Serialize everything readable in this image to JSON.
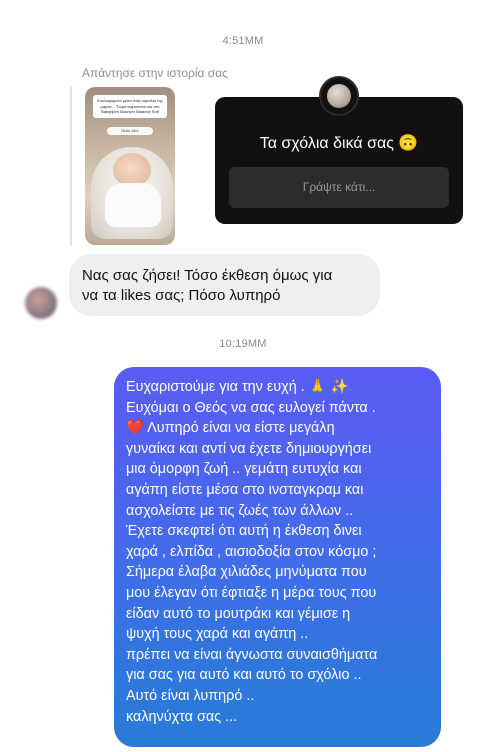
{
  "thread": {
    "timestamp_1": "4:51MM",
    "timestamp_2": "10:19MM"
  },
  "story_reply": {
    "label": "Απάντησε στην ιστορία σας",
    "thumbnail_caption": "Κυκλοφορούν μέσα στην αγκαλιά της μαμάς... Τώρα κοιμούνται και στο Babybjörn Bouncer Balance Soft",
    "thumbnail_sticker": "Πείτε εδώ",
    "sticker_title": "Τα σχόλια δικά σας 🙃",
    "sticker_placeholder": "Γράψτε κάτι..."
  },
  "incoming_message": {
    "lines": [
      "Νας σας ζήσει! Τόσο έκθεση όμως για",
      "να τα likes σας; Πόσο λυπηρό"
    ]
  },
  "outgoing_message": {
    "lines": [
      "Ευχαριστούμε για την ευχή . 🙏 ✨",
      "Ευχόμαι ο Θεός να σας ευλογεί πάντα .",
      "❤️ Λυπηρό είναι να είστε μεγάλη",
      "γυναίκα και αντί να έχετε δημιουργήσει",
      "μια όμορφη ζωή .. γεμάτη ευτυχία και",
      "αγάπη είστε μέσα στο ινσταγκραμ και",
      "ασχολείστε με τις ζωές των άλλων ..",
      "Έχετε σκεφτεί ότι αυτή η έκθεση δινει",
      "χαρά , ελπίδα , αισιοδοξία στον κόσμο ;",
      "Σήμερα έλαβα χιλιάδες μηνύματα που",
      "μου έλεγαν ότι έφτιαξε η μέρα τους που",
      "είδαν αυτό το μουτράκι και γέμισε η",
      "ψυχή τους χαρά και αγάπη ..",
      "πρέπει να είναι άγνωστα συναισθήματα",
      "για σας για αυτό και αυτό το σχόλιο ..",
      "Αυτό είναι λυπηρό ..",
      "καληνύχτα σας ..."
    ]
  },
  "colors": {
    "bubble_gradient_top": "#5a5cf3",
    "bubble_gradient_bottom": "#2a7bd8",
    "incoming_bubble": "#efefef",
    "sticker_card": "#111111"
  }
}
